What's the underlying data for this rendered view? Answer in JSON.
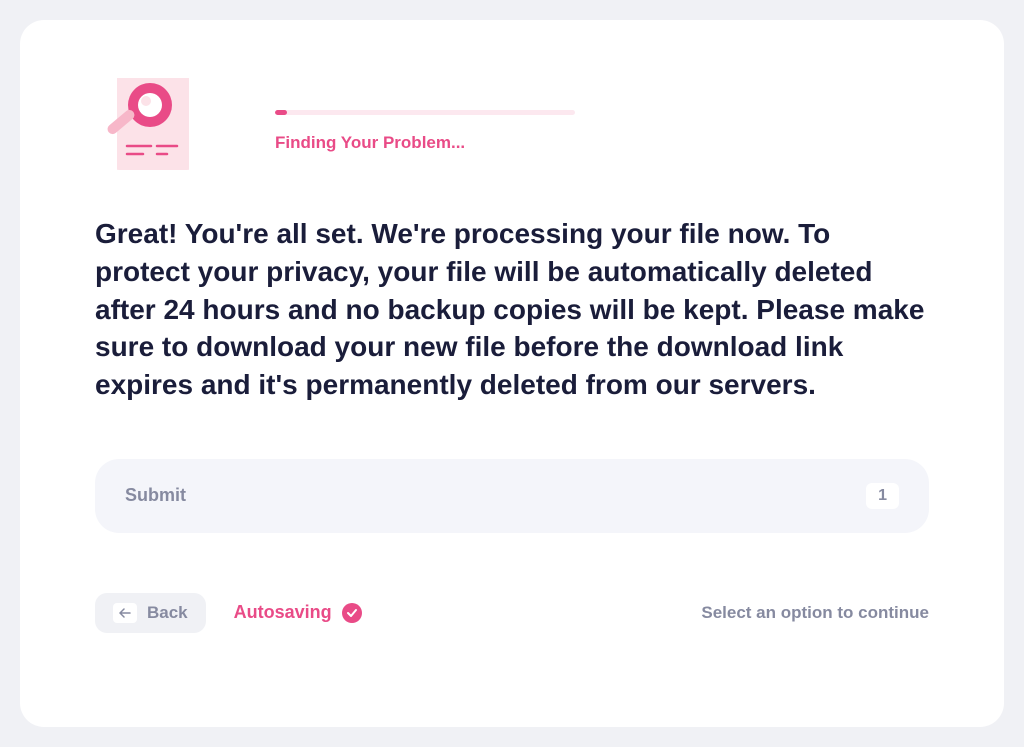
{
  "progress": {
    "label": "Finding Your Problem...",
    "percent": 4
  },
  "message": "Great! You're all set. We're processing your file now. To protect your privacy, your file will be automatically deleted after 24 hours and no backup copies will be kept. Please make sure to download your new file before the download link expires and it's permanently deleted from our servers.",
  "submit": {
    "label": "Submit",
    "count": "1"
  },
  "footer": {
    "back_label": "Back",
    "autosaving_label": "Autosaving",
    "continue_hint": "Select an option to continue"
  }
}
